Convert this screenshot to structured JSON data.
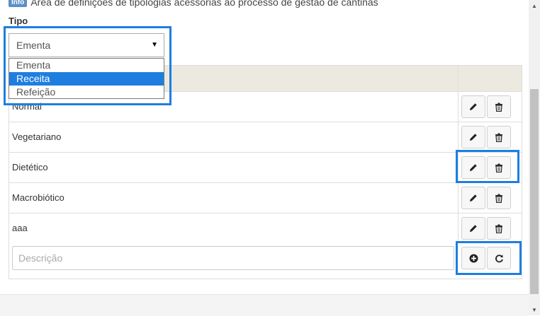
{
  "info": {
    "badge": "Info",
    "text": "Área de definições de tipologias acessórias ao processo de gestão de cantinas"
  },
  "tipo": {
    "label": "Tipo",
    "selected": "Ementa",
    "options": [
      "Ementa",
      "Receita",
      "Refeição"
    ],
    "highlighted_option": "Receita"
  },
  "table": {
    "rows": [
      {
        "descricao": "Normal"
      },
      {
        "descricao": "Vegetariano"
      },
      {
        "descricao": "Dietético"
      },
      {
        "descricao": "Macrobiótico"
      },
      {
        "descricao": "aaa"
      }
    ]
  },
  "new_item": {
    "placeholder": "Descrição",
    "value": ""
  },
  "icons": {
    "edit": "pencil-icon",
    "delete": "trash-icon",
    "add": "plus-circle-icon",
    "reset": "refresh-icon"
  },
  "colors": {
    "highlight": "#1e7ee0",
    "header_bg": "#ece9e0",
    "badge": "#5b8fc7"
  }
}
